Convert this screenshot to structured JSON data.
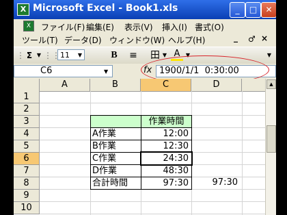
{
  "window": {
    "title": "Microsoft Excel - Book1.xls",
    "app_icon": "excel-icon",
    "controls": {
      "minimize": "_",
      "maximize": "□",
      "close": "✕"
    }
  },
  "menubar": {
    "items": [
      "ファイル(F)",
      "編集(E)",
      "表示(V)",
      "挿入(I)",
      "書式(O)",
      "ツール(T)",
      "データ(D)",
      "ウィンドウ(W)",
      "ヘルプ(H)"
    ],
    "doc_controls": {
      "minimize": "_",
      "restore": "♂",
      "close": "×"
    }
  },
  "toolbar": {
    "sum": "Σ",
    "font_size": "11",
    "bold": "B",
    "align": "≡",
    "borders": "田",
    "fill": "A"
  },
  "formula_bar": {
    "name_box": "C6",
    "fx": "fx",
    "formula": "1900/1/1  0:30:00"
  },
  "sheet": {
    "columns": [
      "A",
      "B",
      "C",
      "D"
    ],
    "rows": [
      "1",
      "2",
      "3",
      "4",
      "5",
      "6",
      "7",
      "8",
      "9",
      "10"
    ],
    "header_c3": "作業時間",
    "tasks": [
      {
        "name": "A作業",
        "time": "12:00"
      },
      {
        "name": "B作業",
        "time": "12:30"
      },
      {
        "name": "C作業",
        "time": "24:30"
      },
      {
        "name": "D作業",
        "time": "48:30"
      }
    ],
    "total_label": "合計時間",
    "total_c": "97:30",
    "total_d": "97:30"
  },
  "colors": {
    "title_bar": "#2457d6",
    "header_fill": "#ccffcc",
    "annotation": "#d8232a",
    "active_header": "#f7c873"
  }
}
